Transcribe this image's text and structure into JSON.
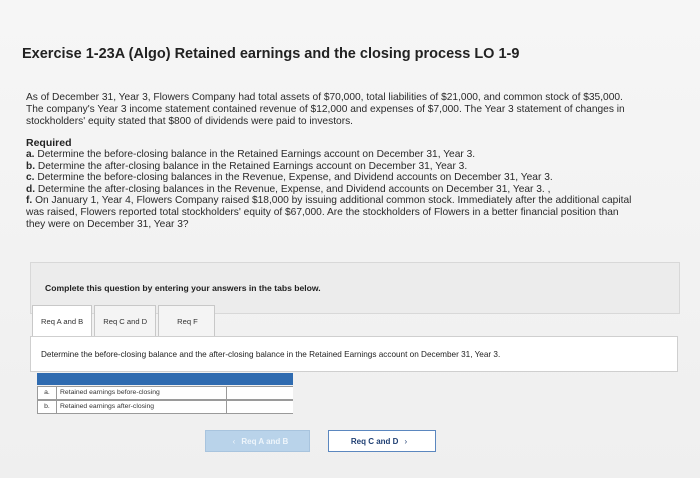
{
  "exercise": {
    "title": "Exercise 1-23A (Algo) Retained earnings and the closing process LO 1-9"
  },
  "intro": {
    "lines": [
      "As of December 31, Year 3, Flowers Company had total assets of $70,000, total liabilities of $21,000, and common stock of $35,000.",
      "The company's Year 3 income statement contained revenue of $12,000 and expenses of $7,000. The Year 3 statement of changes in",
      "stockholders' equity stated that $800 of dividends were paid to investors."
    ]
  },
  "required": {
    "heading": "Required",
    "items": [
      {
        "letter": "a.",
        "text": "Determine the before-closing balance in the Retained Earnings account on December 31, Year 3."
      },
      {
        "letter": "b.",
        "text": "Determine the after-closing balance in the Retained Earnings account on December 31, Year 3."
      },
      {
        "letter": "c.",
        "text": "Determine the before-closing balances in the Revenue, Expense, and Dividend accounts on December 31, Year 3."
      },
      {
        "letter": "d.",
        "text": "Determine the after-closing balances in the Revenue, Expense, and Dividend accounts on December 31, Year 3. ,"
      },
      {
        "letter": "f.",
        "text": "On January 1, Year 4, Flowers Company raised $18,000 by issuing additional common stock. Immediately after the additional capital"
      },
      {
        "letter": "",
        "text": "was raised, Flowers reported total stockholders' equity of $67,000. Are the stockholders of Flowers in a better financial position than"
      },
      {
        "letter": "",
        "text": "they were on December 31, Year 3?"
      }
    ]
  },
  "instruction": "Complete this question by entering your answers in the tabs below.",
  "tabs": [
    {
      "label": "Req A and B",
      "active": true
    },
    {
      "label": "Req C and D",
      "active": false
    },
    {
      "label": "Req F",
      "active": false
    }
  ],
  "panel": {
    "prompt": "Determine the before-closing balance and the after-closing balance in the Retained Earnings account on December 31, Year 3."
  },
  "answers": [
    {
      "letter": "a.",
      "label": "Retained earnings before-closing",
      "value": ""
    },
    {
      "letter": "b.",
      "label": "Retained earnings after-closing",
      "value": ""
    }
  ],
  "nav": {
    "prev_label": "Req A and B",
    "next_label": "Req C and D",
    "prev_chevron": "‹",
    "next_chevron": "›"
  },
  "colors": {
    "accent": "#2f6bb0",
    "prev_button": "#b9d3ea",
    "next_border": "#5b87bf"
  }
}
